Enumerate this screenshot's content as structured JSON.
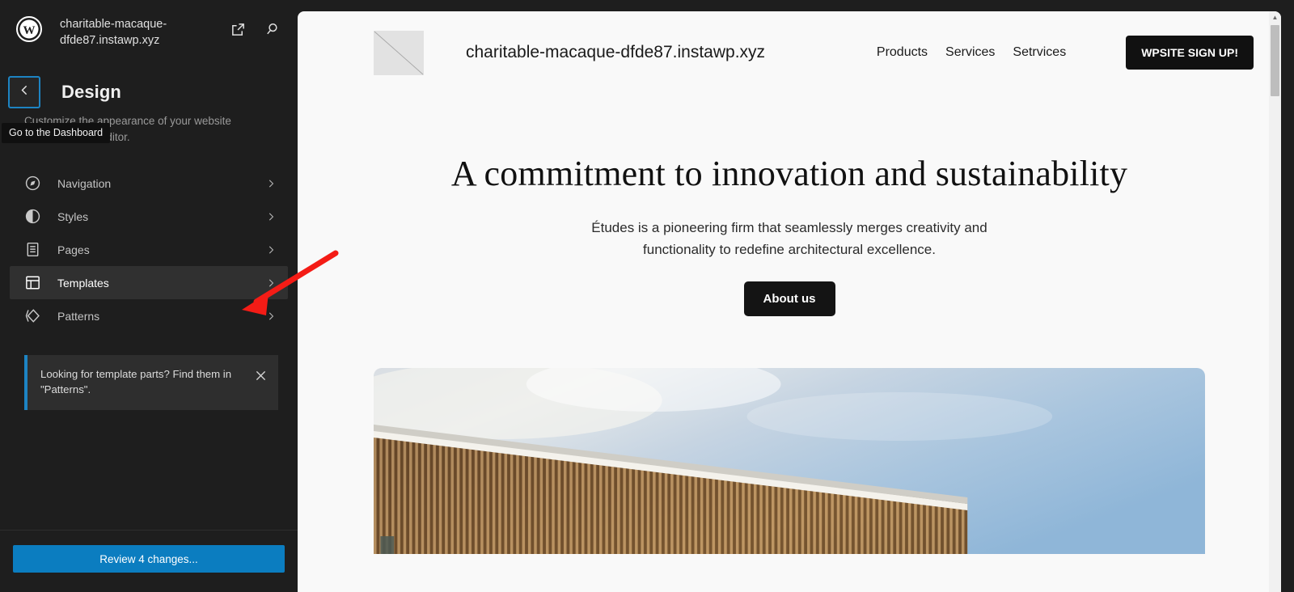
{
  "sidebar": {
    "logo_icon": "wordpress-logo-icon",
    "site_name": "charitable-macaque-dfde87.instawp.xyz",
    "header_icons": [
      {
        "name": "external-link-icon",
        "label": "View site"
      },
      {
        "name": "search-icon",
        "label": "Search"
      }
    ],
    "back_button": {
      "icon": "chevron-left-icon",
      "tooltip": "Go to the Dashboard"
    },
    "title": "Design",
    "description": "Customize the appearance of your website using the block editor.",
    "nav_items": [
      {
        "label": "Navigation",
        "icon": "compass-icon",
        "active": false
      },
      {
        "label": "Styles",
        "icon": "contrast-circle-icon",
        "active": false
      },
      {
        "label": "Pages",
        "icon": "page-document-icon",
        "active": false
      },
      {
        "label": "Templates",
        "icon": "layout-template-icon",
        "active": true
      },
      {
        "label": "Patterns",
        "icon": "diamond-layers-icon",
        "active": false
      }
    ],
    "notice": {
      "text": "Looking for template parts? Find them in \"Patterns\".",
      "close_icon": "close-icon",
      "accent_color": "#1d84c3"
    },
    "footer_button": {
      "label": "Review 4 changes...",
      "color": "#0b7dc0"
    }
  },
  "canvas": {
    "site_header": {
      "logo_placeholder_icon": "image-placeholder-icon",
      "site_title": "charitable-macaque-dfde87.instawp.xyz",
      "nav_links": [
        "Products",
        "Services",
        "Setrvices"
      ],
      "cta_label": "WPSITE SIGN UP!"
    },
    "hero": {
      "heading": "A commitment to innovation and sustainability",
      "paragraph": "Études is a pioneering firm that seamlessly merges creativity and functionality to redefine architectural excellence.",
      "button_label": "About us"
    },
    "hero_image_alt": "Architectural building with wooden slatted facade against a partly cloudy blue sky",
    "scrollbar": {
      "up_arrow_icon": "scroll-up-arrow-icon"
    }
  },
  "annotation": {
    "arrow_color": "#f41c16",
    "points_to": "Templates"
  }
}
